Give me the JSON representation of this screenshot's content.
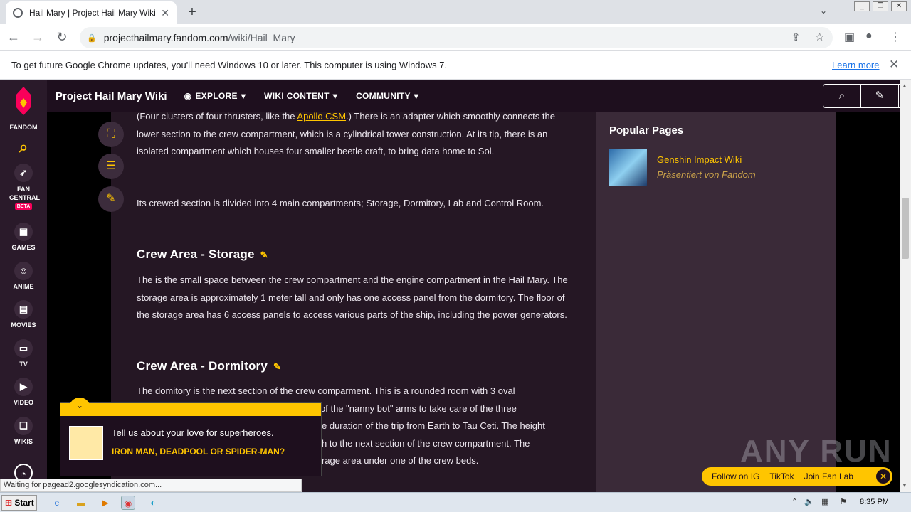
{
  "browser": {
    "tab_title": "Hail Mary | Project Hail Mary Wiki | F",
    "tab_close": "✕",
    "new_tab": "+",
    "url_host": "projecthailmary.fandom.com",
    "url_path": "/wiki/Hail_Mary",
    "infobar_text": "To get future Google Chrome updates, you'll need Windows 10 or later. This computer is using Windows 7.",
    "infobar_link": "Learn more"
  },
  "fandom_sidebar": {
    "brand": "FANDOM",
    "items": [
      {
        "label": "FAN CENTRAL",
        "badge": "BETA"
      },
      {
        "label": "GAMES"
      },
      {
        "label": "ANIME"
      },
      {
        "label": "MOVIES"
      },
      {
        "label": "TV"
      },
      {
        "label": "VIDEO"
      },
      {
        "label": "WIKIS"
      }
    ]
  },
  "wiki_header": {
    "title": "Project Hail Mary Wiki",
    "nav": [
      "EXPLORE",
      "WIKI CONTENT",
      "COMMUNITY"
    ]
  },
  "article": {
    "p1_before": "(Four clusters of four thrusters, like the ",
    "p1_link": "Apollo CSM",
    "p1_after": ".) There is an adapter which smoothly connects the lower section to the crew compartment, which is a cylindrical tower construction. At its tip, there is an isolated compartment which houses four smaller beetle craft, to bring data home to Sol.",
    "p2": "Its crewed section is divided into 4 main compartments; Storage, Dormitory, Lab and Control Room.",
    "h_storage": "Crew Area - Storage",
    "p3": "The is the small space between the crew compartment and the engine compartment in the Hail Mary. The storage area is approximately 1 meter tall and only has one access panel from the dormitory. The floor of the storage area has 6 access panels to access various parts of the ship, including the power generators.",
    "h_dormitory": "Crew Area - Dormitory",
    "p4_l1": "The domitory is the next section of the crew comparment. This is a rounded room with 3 oval",
    "p4_l2": "of the \"nanny bot\" arms to take care of the three",
    "p4_l3": "e duration of the trip from Earth to Tau Ceti. The height",
    "p4_l4": "h to the next section of the crew compartment. The",
    "p4_l5": "rage area under one of the crew beds."
  },
  "popular_pages": {
    "title": "Popular Pages",
    "item_name": "Genshin Impact Wiki",
    "item_sub": "Präsentiert von Fandom"
  },
  "promo": {
    "question": "Tell us about your love for superheroes.",
    "answer": "IRON MAN, DEADPOOL OR SPIDER-MAN?"
  },
  "social": {
    "items": [
      "Follow on IG",
      "TikTok",
      "Join Fan Lab"
    ]
  },
  "status_text": "Waiting for pagead2.googlesyndication.com...",
  "watermark": "ANY RUN",
  "taskbar": {
    "start": "Start",
    "time": "8:35 PM"
  }
}
